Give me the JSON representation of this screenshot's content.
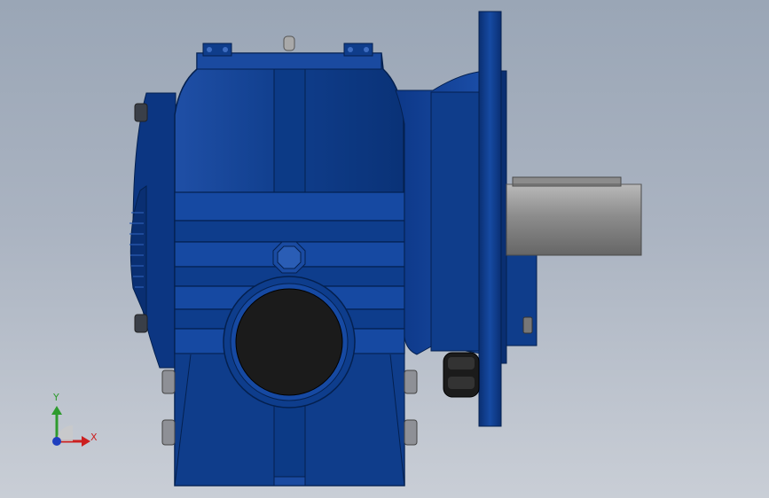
{
  "colors": {
    "background_top": "#9aa6b6",
    "background_bottom": "#c9ced6",
    "housing_blue": "#0e3f8e",
    "housing_dark": "#062a66",
    "housing_light": "#2a5db5",
    "shaft_gray": "#8e8e8e",
    "bore_black": "#1b1b1b",
    "axis_x": "#cc1f1f",
    "axis_y": "#2e9b2e",
    "axis_z": "#1f3fbf"
  },
  "triad": {
    "x_label": "X",
    "y_label": "Y"
  }
}
